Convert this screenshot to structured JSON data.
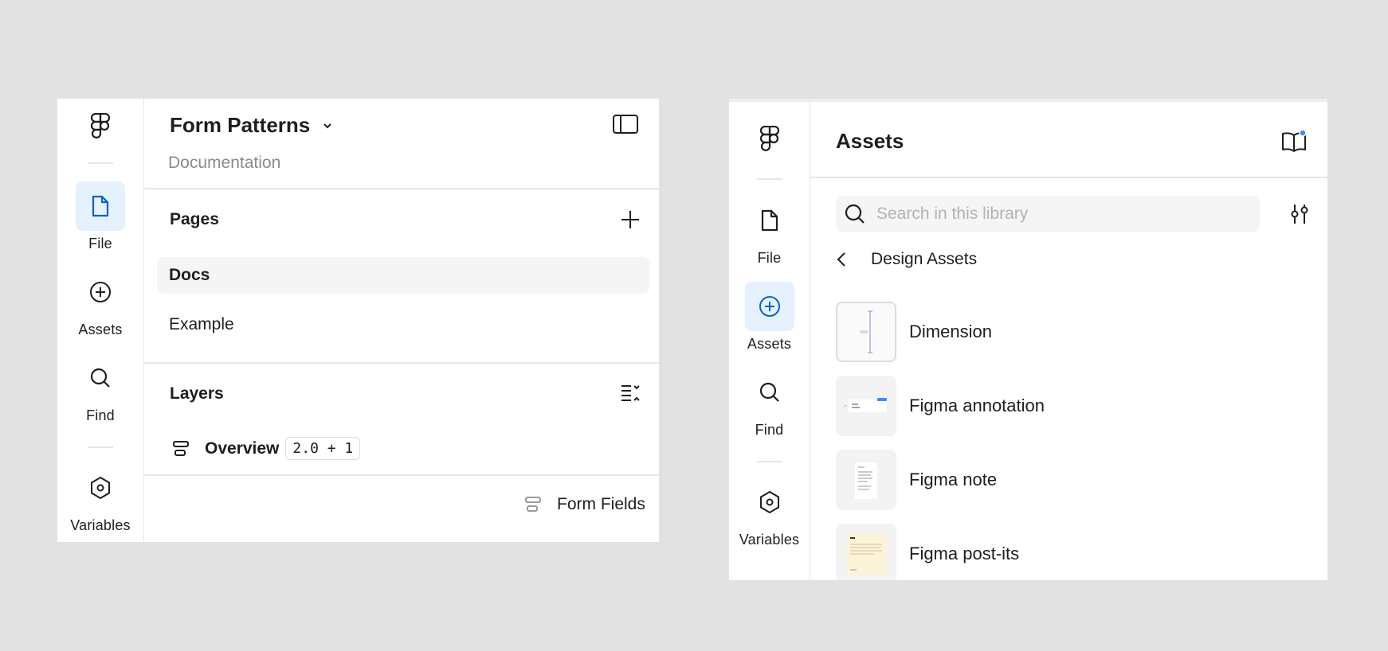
{
  "left_panel": {
    "rail": {
      "items": [
        {
          "label": "File",
          "icon": "file-icon",
          "active": true
        },
        {
          "label": "Assets",
          "icon": "plus-circle-icon",
          "active": false
        },
        {
          "label": "Find",
          "icon": "search-icon",
          "active": false
        },
        {
          "label": "Variables",
          "icon": "hexagon-icon",
          "active": false
        }
      ]
    },
    "header": {
      "title": "Form Patterns",
      "subtitle": "Documentation"
    },
    "pages": {
      "title": "Pages",
      "items": [
        {
          "label": "Docs",
          "selected": true
        },
        {
          "label": "Example",
          "selected": false
        }
      ]
    },
    "layers": {
      "title": "Layers",
      "top_layer": {
        "name": "Overview",
        "badge": "2.0 + 1"
      },
      "child_layer": {
        "name": "Form Fields"
      }
    }
  },
  "right_panel": {
    "rail": {
      "items": [
        {
          "label": "File",
          "icon": "file-icon",
          "active": false
        },
        {
          "label": "Assets",
          "icon": "plus-circle-icon",
          "active": true
        },
        {
          "label": "Find",
          "icon": "search-icon",
          "active": false
        },
        {
          "label": "Variables",
          "icon": "hexagon-icon",
          "active": false
        }
      ]
    },
    "header": {
      "title": "Assets"
    },
    "search": {
      "placeholder": "Search in this library",
      "value": ""
    },
    "breadcrumb": {
      "label": "Design Assets"
    },
    "assets": [
      {
        "name": "Dimension"
      },
      {
        "name": "Figma annotation"
      },
      {
        "name": "Figma note"
      },
      {
        "name": "Figma post-its"
      }
    ]
  },
  "colors": {
    "accent": "#0d63c4",
    "accent_bg": "#e5f1fc",
    "badge_dot": "#3d8ef0",
    "background": "#e2e2e2"
  }
}
